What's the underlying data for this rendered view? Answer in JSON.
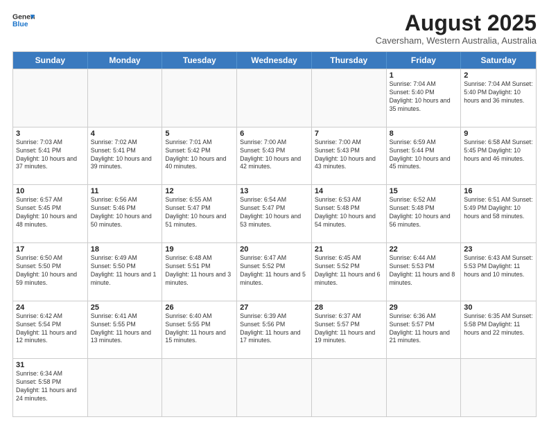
{
  "header": {
    "logo_line1": "General",
    "logo_line2": "Blue",
    "month_title": "August 2025",
    "subtitle": "Caversham, Western Australia, Australia"
  },
  "days_of_week": [
    "Sunday",
    "Monday",
    "Tuesday",
    "Wednesday",
    "Thursday",
    "Friday",
    "Saturday"
  ],
  "weeks": [
    [
      {
        "day": "",
        "info": ""
      },
      {
        "day": "",
        "info": ""
      },
      {
        "day": "",
        "info": ""
      },
      {
        "day": "",
        "info": ""
      },
      {
        "day": "",
        "info": ""
      },
      {
        "day": "1",
        "info": "Sunrise: 7:04 AM\nSunset: 5:40 PM\nDaylight: 10 hours\nand 35 minutes."
      },
      {
        "day": "2",
        "info": "Sunrise: 7:04 AM\nSunset: 5:40 PM\nDaylight: 10 hours\nand 36 minutes."
      }
    ],
    [
      {
        "day": "3",
        "info": "Sunrise: 7:03 AM\nSunset: 5:41 PM\nDaylight: 10 hours\nand 37 minutes."
      },
      {
        "day": "4",
        "info": "Sunrise: 7:02 AM\nSunset: 5:41 PM\nDaylight: 10 hours\nand 39 minutes."
      },
      {
        "day": "5",
        "info": "Sunrise: 7:01 AM\nSunset: 5:42 PM\nDaylight: 10 hours\nand 40 minutes."
      },
      {
        "day": "6",
        "info": "Sunrise: 7:00 AM\nSunset: 5:43 PM\nDaylight: 10 hours\nand 42 minutes."
      },
      {
        "day": "7",
        "info": "Sunrise: 7:00 AM\nSunset: 5:43 PM\nDaylight: 10 hours\nand 43 minutes."
      },
      {
        "day": "8",
        "info": "Sunrise: 6:59 AM\nSunset: 5:44 PM\nDaylight: 10 hours\nand 45 minutes."
      },
      {
        "day": "9",
        "info": "Sunrise: 6:58 AM\nSunset: 5:45 PM\nDaylight: 10 hours\nand 46 minutes."
      }
    ],
    [
      {
        "day": "10",
        "info": "Sunrise: 6:57 AM\nSunset: 5:45 PM\nDaylight: 10 hours\nand 48 minutes."
      },
      {
        "day": "11",
        "info": "Sunrise: 6:56 AM\nSunset: 5:46 PM\nDaylight: 10 hours\nand 50 minutes."
      },
      {
        "day": "12",
        "info": "Sunrise: 6:55 AM\nSunset: 5:47 PM\nDaylight: 10 hours\nand 51 minutes."
      },
      {
        "day": "13",
        "info": "Sunrise: 6:54 AM\nSunset: 5:47 PM\nDaylight: 10 hours\nand 53 minutes."
      },
      {
        "day": "14",
        "info": "Sunrise: 6:53 AM\nSunset: 5:48 PM\nDaylight: 10 hours\nand 54 minutes."
      },
      {
        "day": "15",
        "info": "Sunrise: 6:52 AM\nSunset: 5:48 PM\nDaylight: 10 hours\nand 56 minutes."
      },
      {
        "day": "16",
        "info": "Sunrise: 6:51 AM\nSunset: 5:49 PM\nDaylight: 10 hours\nand 58 minutes."
      }
    ],
    [
      {
        "day": "17",
        "info": "Sunrise: 6:50 AM\nSunset: 5:50 PM\nDaylight: 10 hours\nand 59 minutes."
      },
      {
        "day": "18",
        "info": "Sunrise: 6:49 AM\nSunset: 5:50 PM\nDaylight: 11 hours\nand 1 minute."
      },
      {
        "day": "19",
        "info": "Sunrise: 6:48 AM\nSunset: 5:51 PM\nDaylight: 11 hours\nand 3 minutes."
      },
      {
        "day": "20",
        "info": "Sunrise: 6:47 AM\nSunset: 5:52 PM\nDaylight: 11 hours\nand 5 minutes."
      },
      {
        "day": "21",
        "info": "Sunrise: 6:45 AM\nSunset: 5:52 PM\nDaylight: 11 hours\nand 6 minutes."
      },
      {
        "day": "22",
        "info": "Sunrise: 6:44 AM\nSunset: 5:53 PM\nDaylight: 11 hours\nand 8 minutes."
      },
      {
        "day": "23",
        "info": "Sunrise: 6:43 AM\nSunset: 5:53 PM\nDaylight: 11 hours\nand 10 minutes."
      }
    ],
    [
      {
        "day": "24",
        "info": "Sunrise: 6:42 AM\nSunset: 5:54 PM\nDaylight: 11 hours\nand 12 minutes."
      },
      {
        "day": "25",
        "info": "Sunrise: 6:41 AM\nSunset: 5:55 PM\nDaylight: 11 hours\nand 13 minutes."
      },
      {
        "day": "26",
        "info": "Sunrise: 6:40 AM\nSunset: 5:55 PM\nDaylight: 11 hours\nand 15 minutes."
      },
      {
        "day": "27",
        "info": "Sunrise: 6:39 AM\nSunset: 5:56 PM\nDaylight: 11 hours\nand 17 minutes."
      },
      {
        "day": "28",
        "info": "Sunrise: 6:37 AM\nSunset: 5:57 PM\nDaylight: 11 hours\nand 19 minutes."
      },
      {
        "day": "29",
        "info": "Sunrise: 6:36 AM\nSunset: 5:57 PM\nDaylight: 11 hours\nand 21 minutes."
      },
      {
        "day": "30",
        "info": "Sunrise: 6:35 AM\nSunset: 5:58 PM\nDaylight: 11 hours\nand 22 minutes."
      }
    ],
    [
      {
        "day": "31",
        "info": "Sunrise: 6:34 AM\nSunset: 5:58 PM\nDaylight: 11 hours\nand 24 minutes."
      },
      {
        "day": "",
        "info": ""
      },
      {
        "day": "",
        "info": ""
      },
      {
        "day": "",
        "info": ""
      },
      {
        "day": "",
        "info": ""
      },
      {
        "day": "",
        "info": ""
      },
      {
        "day": "",
        "info": ""
      }
    ]
  ]
}
